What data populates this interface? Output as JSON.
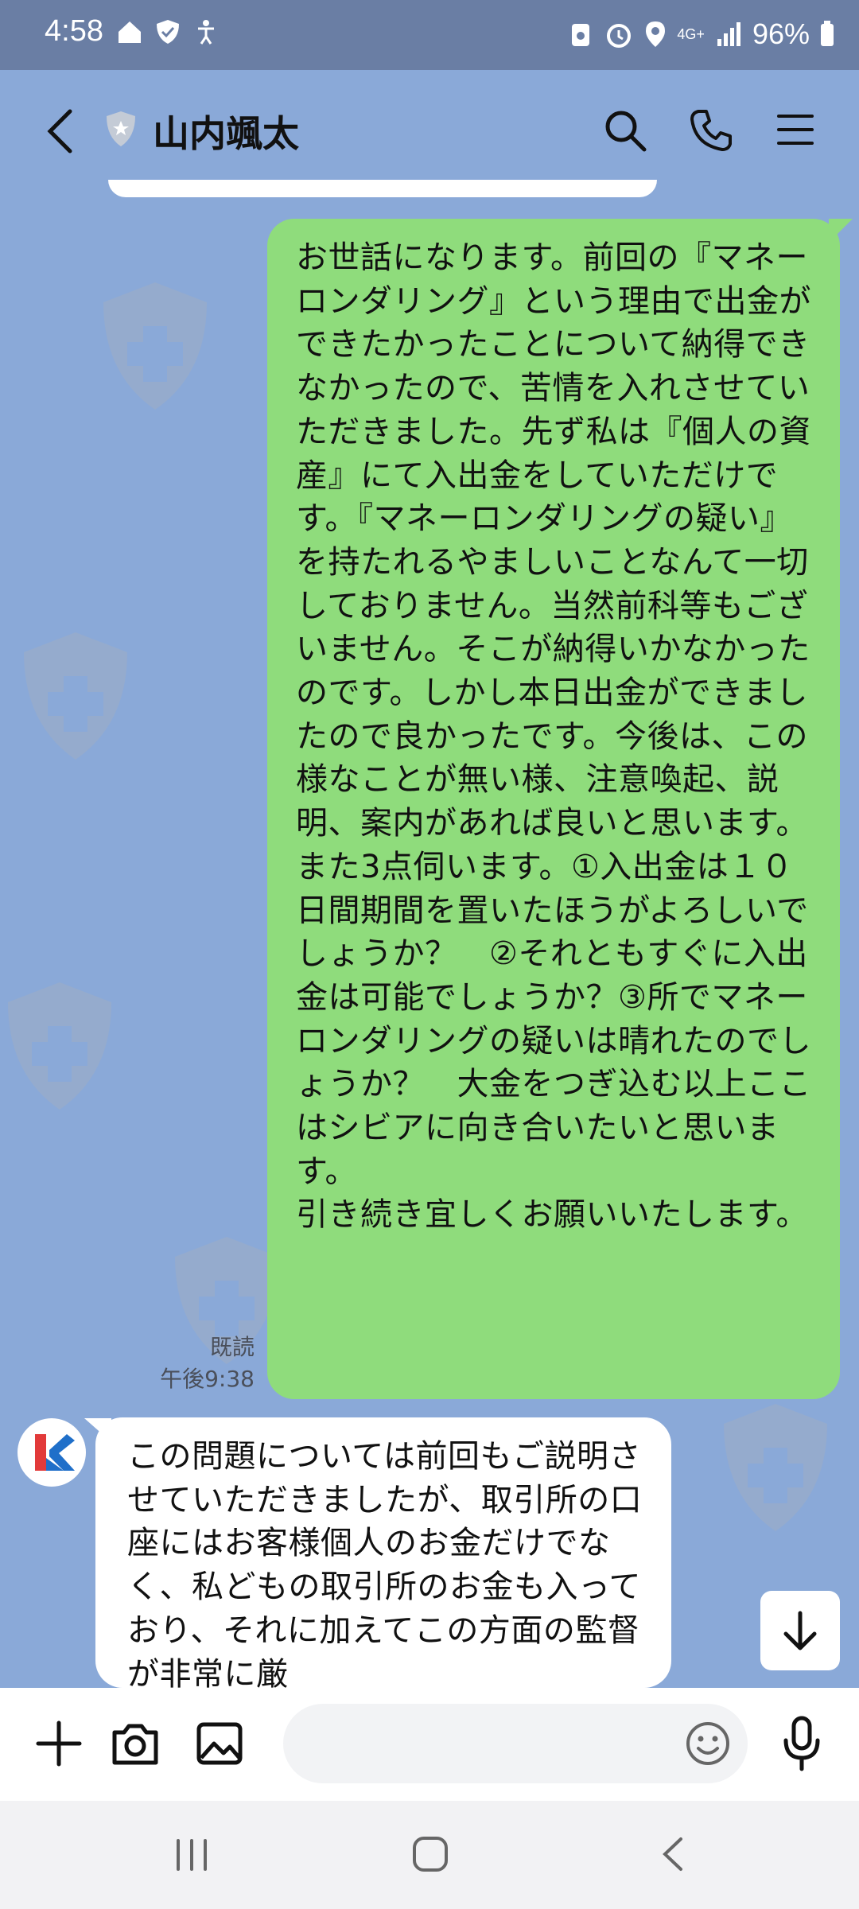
{
  "status_bar": {
    "time": "4:58",
    "left_icons": [
      "home-icon",
      "shield-check-icon",
      "accessibility-icon"
    ],
    "right_icons": [
      "battery-saver-icon",
      "alarm-icon",
      "location-icon",
      "4g-icon",
      "signal-icon"
    ],
    "network": "4G+",
    "battery": "96%"
  },
  "header": {
    "title": "山内颯太",
    "icons": [
      "back-icon",
      "shield-badge-icon",
      "search-icon",
      "phone-icon",
      "menu-icon"
    ]
  },
  "messages": [
    {
      "side": "sent",
      "text": "お世話になります。前回の『マネーロンダリング』という理由で出金ができたかったことについて納得できなかったので、苦情を入れさせていただきました。先ず私は『個人の資産』にて入出金をしていただけです。『マネーロンダリングの疑い』を持たれるやましいことなんて一切しておりません。当然前科等もございません。そこが納得いかなかったのです。しかし本日出金ができましたので良かったです。今後は、この様なことが無い様、注意喚起、説明、案内があれば良いと思います。また3点伺います。①入出金は１０日間期間を置いたほうがよろしいでしょうか？　②それともすぐに入出金は可能でしょうか？③所でマネーロンダリングの疑いは晴れたのでしょうか？　大金をつぎ込む以上ここはシビアに向き合いたいと思います。\n引き続き宜しくお願いいたします。",
      "read": "既読",
      "time": "午後9:38"
    },
    {
      "side": "received",
      "text": "この問題については前回もご説明させていただきましたが、取引所の口座にはお客様個人のお金だけでなく、私どもの取引所のお金も入っており、それに加えてこの方面の監督が非常に厳"
    }
  ],
  "input_bar": {
    "placeholder": "",
    "icons": [
      "plus-icon",
      "camera-icon",
      "image-icon",
      "emoji-icon",
      "mic-icon"
    ]
  },
  "nav_bar": {
    "icons": [
      "recents-icon",
      "home-icon",
      "back-icon"
    ]
  },
  "colors": {
    "background": "#8aa9d8",
    "status_bar": "#6a7ea4",
    "sent_bubble": "#8fdc7c",
    "received_bubble": "#ffffff"
  }
}
